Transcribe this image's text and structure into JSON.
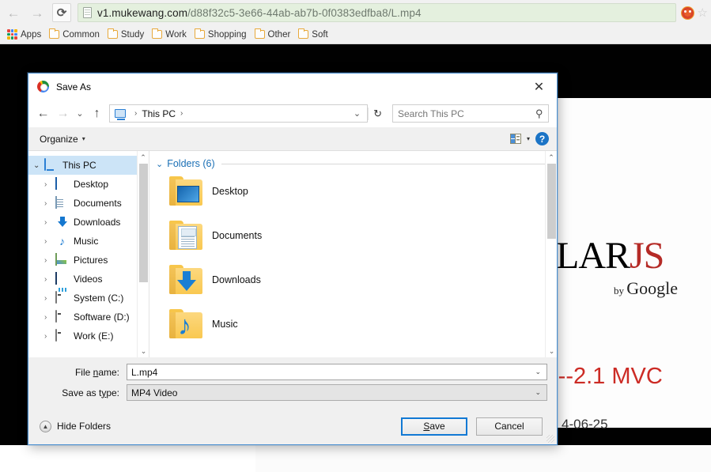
{
  "browser": {
    "back_icon": "back-arrow-icon",
    "forward_icon": "forward-arrow-icon",
    "reload_label": "⟳",
    "url_prefix": "v1.mukewang.com",
    "url_path": "/d88f32c5-3e66-44ab-ab7b-0f0383edfba8/L.mp4",
    "url_full": "v1.mukewang.com/d88f32c5-3e66-44ab-ab7b-0f0383edfba8/L.mp4",
    "urlbar_bg": "#e4f0de",
    "star_glyph": "☆",
    "bookmarks": [
      {
        "label": "Apps",
        "icon": "apps-grid-icon"
      },
      {
        "label": "Common",
        "icon": "folder-icon"
      },
      {
        "label": "Study",
        "icon": "folder-icon"
      },
      {
        "label": "Work",
        "icon": "folder-icon"
      },
      {
        "label": "Shopping",
        "icon": "folder-icon"
      },
      {
        "label": "Other",
        "icon": "folder-icon"
      },
      {
        "label": "Soft",
        "icon": "folder-icon"
      }
    ]
  },
  "page_background": {
    "logo_text": "LARJS",
    "logo_plain": "LAR",
    "logo_accent": "JS",
    "byline_prefix": "by",
    "byline_brand": "Google",
    "mvc_text": "---2.1 MVC",
    "date_text": "4-06-25",
    "accent_color": "#b52b27",
    "mvc_color": "#cc2b25"
  },
  "dialog": {
    "title": "Save As",
    "title_icon": "chrome-logo-icon",
    "close_glyph": "✕",
    "nav": {
      "back_glyph": "←",
      "forward_glyph": "→",
      "recent_glyph": "⌄",
      "up_glyph": "↑",
      "location_icon": "this-pc-icon",
      "breadcrumb_sep": "›",
      "breadcrumb": "This PC",
      "dropdown_glyph": "⌄",
      "refresh_glyph": "↻",
      "search_placeholder": "Search This PC",
      "search_value": "",
      "search_icon": "magnifier-icon"
    },
    "toolbar": {
      "organize_label": "Organize",
      "organize_caret": "▾",
      "view_icon": "view-layout-icon",
      "view_caret": "▾",
      "help_label": "?"
    },
    "sidebar": {
      "items": [
        {
          "label": "This PC",
          "icon": "this-pc-icon",
          "depth": 0,
          "selected": true,
          "chevron": "⌄"
        },
        {
          "label": "Desktop",
          "icon": "desktop-icon",
          "depth": 1,
          "selected": false,
          "chevron": "›"
        },
        {
          "label": "Documents",
          "icon": "documents-icon",
          "depth": 1,
          "selected": false,
          "chevron": "›"
        },
        {
          "label": "Downloads",
          "icon": "downloads-icon",
          "depth": 1,
          "selected": false,
          "chevron": "›"
        },
        {
          "label": "Music",
          "icon": "music-icon",
          "depth": 1,
          "selected": false,
          "chevron": "›"
        },
        {
          "label": "Pictures",
          "icon": "pictures-icon",
          "depth": 1,
          "selected": false,
          "chevron": "›"
        },
        {
          "label": "Videos",
          "icon": "videos-icon",
          "depth": 1,
          "selected": false,
          "chevron": "›"
        },
        {
          "label": "System (C:)",
          "icon": "system-drive-icon",
          "depth": 1,
          "selected": false,
          "chevron": "›"
        },
        {
          "label": "Software (D:)",
          "icon": "drive-icon",
          "depth": 1,
          "selected": false,
          "chevron": "›"
        },
        {
          "label": "Work (E:)",
          "icon": "drive-icon",
          "depth": 1,
          "selected": false,
          "chevron": "›"
        }
      ],
      "scroll_up_glyph": "⌃",
      "scroll_down_glyph": "⌄"
    },
    "files": {
      "group_title": "Folders (6)",
      "group_chevron": "⌄",
      "items": [
        {
          "label": "Desktop",
          "icon": "folder-desktop-icon"
        },
        {
          "label": "Documents",
          "icon": "folder-documents-icon"
        },
        {
          "label": "Downloads",
          "icon": "folder-downloads-icon"
        },
        {
          "label": "Music",
          "icon": "folder-music-icon"
        }
      ],
      "scroll_up_glyph": "⌃",
      "scroll_down_glyph": "⌄"
    },
    "form": {
      "filename_label_pre": "File ",
      "filename_label_key": "n",
      "filename_label_post": "ame:",
      "filename_label": "File name:",
      "filename_value": "L.mp4",
      "filetype_label_pre": "Save as t",
      "filetype_label_key": "y",
      "filetype_label_post": "pe:",
      "filetype_label": "Save as type:",
      "filetype_value": "MP4 Video",
      "caret_glyph": "⌄"
    },
    "footer": {
      "hide_folders_label": "Hide Folders",
      "hide_folders_glyph": "▲",
      "save_label": "Save",
      "save_key": "S",
      "save_rest": "ave",
      "cancel_label": "Cancel"
    }
  }
}
